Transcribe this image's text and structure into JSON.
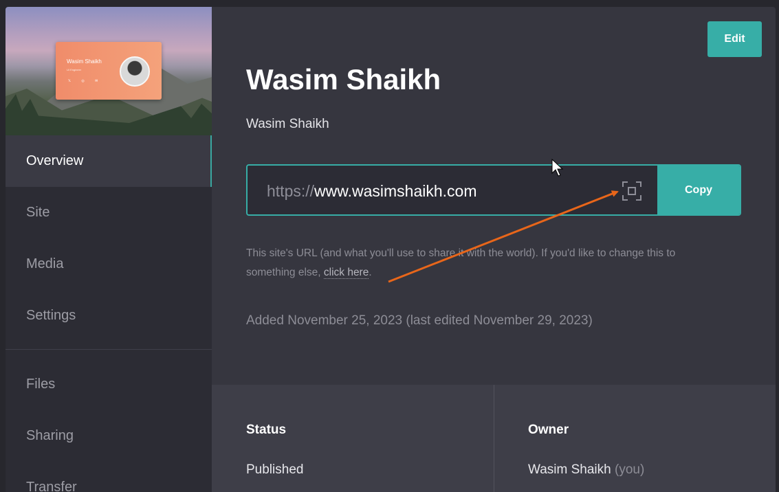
{
  "sidebar": {
    "preview_card": {
      "name": "Wasim Shaikh",
      "role": "UI Engineer",
      "icons": [
        "x-icon",
        "rss-icon",
        "mail-icon"
      ],
      "icon_glyphs": "𝕏 ◎ ✉"
    },
    "items": [
      {
        "label": "Overview",
        "active": true
      },
      {
        "label": "Site"
      },
      {
        "label": "Media"
      },
      {
        "label": "Settings"
      },
      {
        "label": "Files"
      },
      {
        "label": "Sharing"
      },
      {
        "label": "Transfer"
      }
    ]
  },
  "header": {
    "edit_label": "Edit",
    "title": "Wasim Shaikh",
    "subtitle": "Wasim Shaikh"
  },
  "url": {
    "protocol": "https://",
    "host": "www.wasimshaikh.com",
    "qr_icon": "qr-frame-icon",
    "copy_label": "Copy"
  },
  "help": {
    "text": "This site's URL (and what you'll use to share it with the world). If you'd like to change this to something else, ",
    "link": "click here",
    "end": "."
  },
  "dates": {
    "added": "Added November 25, 2023 (last edited November 29, 2023)"
  },
  "info": {
    "status_label": "Status",
    "status_value": "Published",
    "owner_label": "Owner",
    "owner_value": "Wasim Shaikh",
    "owner_suffix": "(you)"
  },
  "colors": {
    "accent": "#37aea7",
    "annotation_arrow": "#e8661a",
    "panel_bg": "#36363f",
    "sidebar_bg": "#2c2c34"
  }
}
